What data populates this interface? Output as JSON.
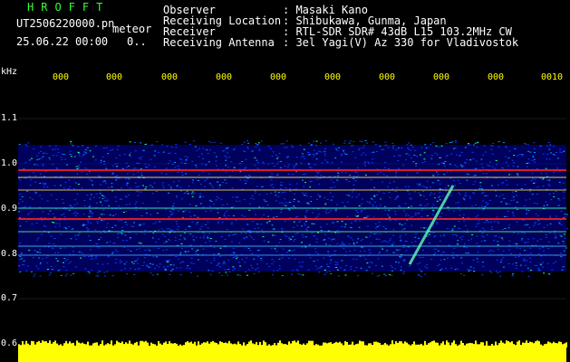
{
  "header": {
    "brand": "HROFFT",
    "filename": "UT2506220000.pn",
    "mode": "meteor",
    "datetime": "25.06.22 00:00",
    "counter": "0..",
    "fields": [
      {
        "label": "Observer",
        "value": ": Masaki Kano"
      },
      {
        "label": "Receiving Location",
        "value": ": Shibukawa, Gunma, Japan"
      },
      {
        "label": "Receiver",
        "value": ": RTL-SDR SDR# 43dB L15 103.2MHz CW"
      },
      {
        "label": "Receiving Antenna",
        "value": ": 3el Yagi(V) Az 330 for Vladivostok"
      }
    ]
  },
  "spectrogram": {
    "yunit": "kHz",
    "yticks": [
      "1.1",
      "1.0",
      "0.9",
      "0.8",
      "0.7",
      "0.6"
    ],
    "xticks": [
      "000",
      "000",
      "000",
      "000",
      "000",
      "000",
      "000",
      "000",
      "000",
      "0010"
    ],
    "colors": {
      "background": "#000000",
      "noise_low": "#0000aa",
      "noise_mid": "#00a0ff",
      "signal": "#ff2020",
      "level_bar": "#ffff00",
      "brand": "#33ff33"
    }
  }
}
